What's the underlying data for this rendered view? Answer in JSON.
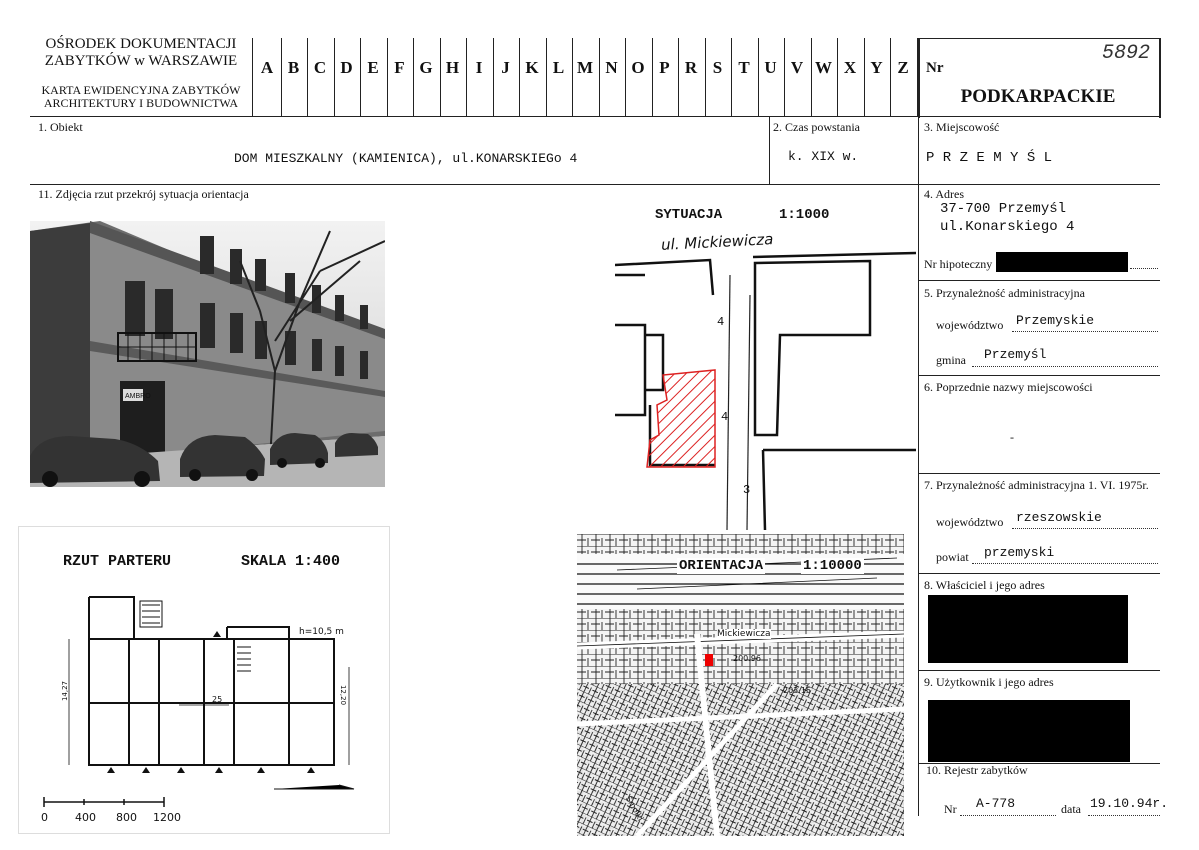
{
  "header": {
    "org_line1": "OŚRODEK DOKUMENTACJI",
    "org_line2": "ZABYTKÓW w WARSZAWIE",
    "card_line1": "KARTA EWIDENCYJNA ZABYTKÓW",
    "card_line2": "ARCHITEKTURY I BUDOWNICTWA",
    "letters": [
      "A",
      "B",
      "C",
      "D",
      "E",
      "F",
      "G",
      "H",
      "I",
      "J",
      "K",
      "L",
      "M",
      "N",
      "O",
      "P",
      "R",
      "S",
      "T",
      "U",
      "V",
      "W",
      "X",
      "Y",
      "Z"
    ],
    "nr_label": "Nr",
    "nr_value": "5892",
    "region": "PODKARPACKIE"
  },
  "fields": {
    "object_label": "1. Obiekt",
    "object_value": "DOM MIESZKALNY (KAMIENICA), ul.KONARSKIEGo 4",
    "period_label": "2. Czas powstania",
    "period_value": "k. XIX w.",
    "place_label": "3. Miejscowość",
    "place_value": "P R Z E M Y Ś L",
    "photos_label": "11. Zdjęcia rzut przekrój sytuacja orientacja",
    "address_label": "4. Adres",
    "address_line1": "37-700 Przemyśl",
    "address_line2": "ul.Konarskiego 4",
    "mortgage_label": "Nr hipoteczny",
    "admin_label": "5. Przynależność administracyjna",
    "voivodeship_label": "województwo",
    "voivodeship_value": "Przemyskie",
    "commune_label": "gmina",
    "commune_value": "Przemyśl",
    "prev_names_label": "6. Poprzednie nazwy miejscowości",
    "prev_names_value": "-",
    "admin1975_label": "7. Przynależność administracyjna 1. VI. 1975r.",
    "voivodeship1975_label": "województwo",
    "voivodeship1975_value": "rzeszowskie",
    "county_label": "powiat",
    "county_value": "przemyski",
    "owner_label": "8. Właściciel i jego adres",
    "user_label": "9. Użytkownik i jego adres",
    "register_label": "10. Rejestr zabytków",
    "register_nr_label": "Nr",
    "register_nr_value": "A-778",
    "register_date_label": "data",
    "register_date_value": "19.10.94r."
  },
  "situation": {
    "title": "SYTUACJA",
    "scale": "1:1000",
    "street": "ul. Mickiewicza",
    "number_a": "4",
    "number_b": "4",
    "number_c": "3"
  },
  "plan": {
    "title": "RZUT PARTERU",
    "scale": "SKALA 1:400",
    "height_note": "h=10,5 m",
    "dim_width": "25",
    "dim_left": "14,27",
    "dim_right": "12,20",
    "scale_ticks": [
      "0",
      "400",
      "800",
      "1200"
    ]
  },
  "orientation": {
    "title": "ORIENTACJA",
    "scale": "1:10000",
    "street": "Mickiewicza",
    "elev1": "200.96",
    "elev2": "203.15",
    "street2": "Smolki"
  },
  "photo": {
    "sign": "AMBRO"
  }
}
